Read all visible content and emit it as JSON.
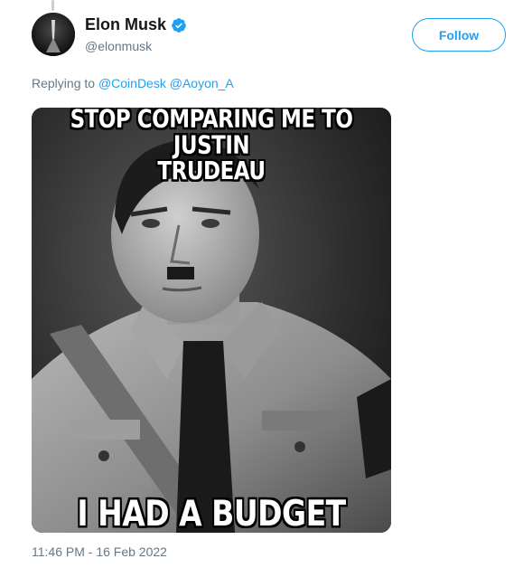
{
  "tweet": {
    "author": {
      "display_name": "Elon Musk",
      "handle": "@elonmusk",
      "verified": true,
      "avatar_icon": "profile-avatar"
    },
    "follow_label": "Follow",
    "replying_prefix": "Replying to",
    "replying_to": [
      "@CoinDesk",
      "@Aoyon_A"
    ],
    "meme": {
      "top_text_line1": "STOP COMPARING ME TO JUSTIN",
      "top_text_line2": "TRUDEAU",
      "bottom_text": "I HAD A BUDGET"
    },
    "timestamp": "11:46 PM - 16 Feb 2022"
  },
  "colors": {
    "accent": "#1da1f2",
    "secondary_text": "#657786",
    "primary_text": "#14171a"
  }
}
